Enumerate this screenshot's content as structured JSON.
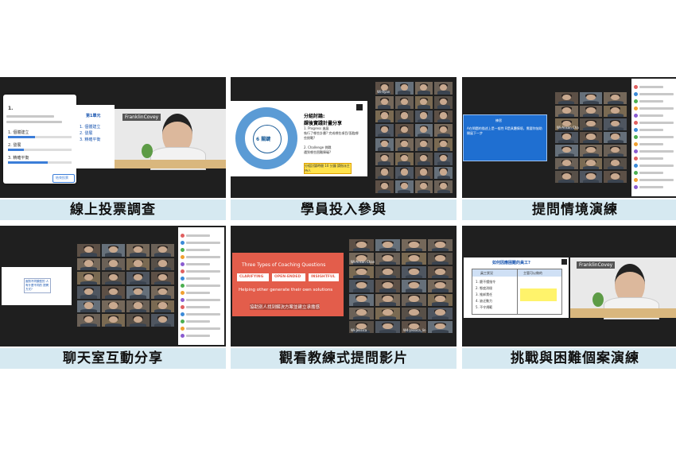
{
  "panels": [
    {
      "caption": "線上投票調查",
      "poll": {
        "title": "1.",
        "options": [
          "1. 個體建立",
          "2. 發展",
          "3. 精確平衡"
        ],
        "bars": [
          0.42,
          0.25,
          0.63
        ],
        "button": "結束投票"
      },
      "slide": {
        "header": "第1單元",
        "logo": "FranklinCovey",
        "items": [
          "1. 個體建立",
          "2. 發展",
          "3. 精確平衡"
        ]
      },
      "logo": "FranklinCovey"
    },
    {
      "caption": "學員投入參與",
      "slide": {
        "circle_label": "6 關鍵",
        "title": "分組討論:\n課後實踐計畫分享",
        "p1": "1. Progress 進展\n執行了哪些計畫? 完成哪些項目/面臨哪些挑戰?",
        "p2": "2. Challenge 挑戰\n遇到哪些困難障礙?",
        "note": "分組討論時間 10 分鐘 請指派主持人"
      },
      "names": [
        "Wi-Ryan"
      ]
    },
    {
      "caption": "提問情境演練",
      "slide": {
        "title": "練習",
        "text": "A在問題的描述上是一般性 B是具體情境，需要你協助開展下一步"
      },
      "names": [
        "Ariel",
        "Wi-Anson Chang"
      ]
    },
    {
      "caption": "聊天室互動分享",
      "note": "面對不同類型的 人有什麼不同的 提問方式?",
      "names": []
    },
    {
      "caption": "觀看教練式提問影片",
      "video": {
        "title": "Three Types of Coaching Questions",
        "tags": [
          "CLARIFYING",
          "OPEN-ENDED",
          "INSIGHTFUL"
        ],
        "subtitle": "Helping other generate their own solutions",
        "subtitle_zh": "協助別人找到解決方案並建立承擔感"
      },
      "names": [
        "Wi-Anson Chang",
        "Wi-Jessica",
        "W4-Jessica_lin"
      ]
    },
    {
      "caption": "挑戰與困難個案演練",
      "table": {
        "title": "如何因應困難的員工?",
        "col1": "員工狀況",
        "col2": "主管可以做的",
        "rows": [
          "1. 聽不懂指令",
          "2. 態度消極",
          "3. 推卸責任",
          "4. 缺乏動力",
          "5. 不守規範"
        ]
      },
      "logo": "FranklinCovey"
    }
  ]
}
